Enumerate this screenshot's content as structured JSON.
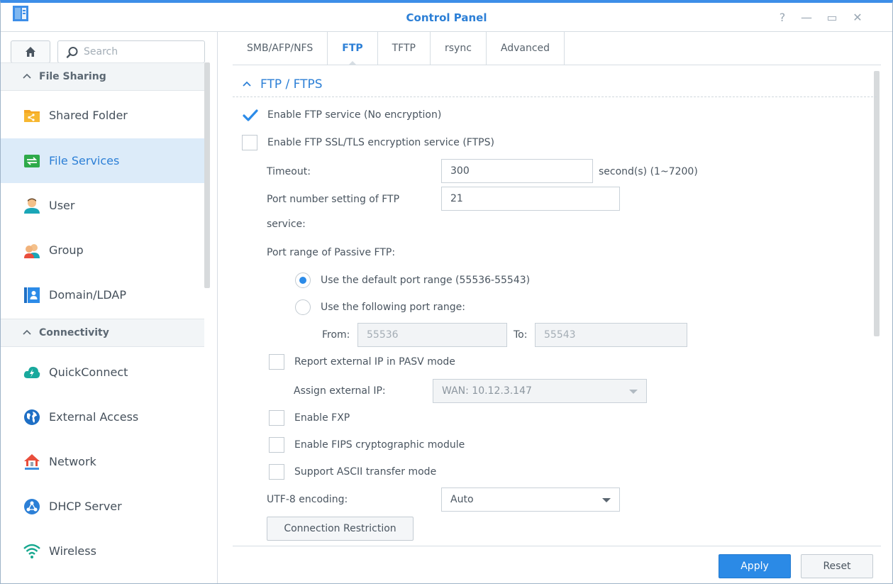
{
  "window": {
    "title": "Control Panel",
    "controls": {
      "help": "?",
      "minimize": "—",
      "maximize": "▭",
      "close": "✕"
    }
  },
  "sidebar": {
    "search_placeholder": "Search",
    "sections": [
      {
        "label": "File Sharing",
        "items": [
          {
            "label": "Shared Folder",
            "icon": "shared-folder-icon"
          },
          {
            "label": "File Services",
            "icon": "file-services-icon",
            "active": true
          },
          {
            "label": "User",
            "icon": "user-icon"
          },
          {
            "label": "Group",
            "icon": "group-icon"
          },
          {
            "label": "Domain/LDAP",
            "icon": "domain-ldap-icon"
          }
        ]
      },
      {
        "label": "Connectivity",
        "items": [
          {
            "label": "QuickConnect",
            "icon": "quickconnect-icon"
          },
          {
            "label": "External Access",
            "icon": "external-access-icon"
          },
          {
            "label": "Network",
            "icon": "network-icon"
          },
          {
            "label": "DHCP Server",
            "icon": "dhcp-server-icon"
          },
          {
            "label": "Wireless",
            "icon": "wireless-icon"
          }
        ]
      }
    ]
  },
  "tabs": [
    {
      "label": "SMB/AFP/NFS"
    },
    {
      "label": "FTP",
      "active": true
    },
    {
      "label": "TFTP"
    },
    {
      "label": "rsync"
    },
    {
      "label": "Advanced"
    }
  ],
  "ftp": {
    "section_title": "FTP / FTPS",
    "enable_ftp": {
      "label": "Enable FTP service (No encryption)",
      "checked": true
    },
    "enable_ftps": {
      "label": "Enable FTP SSL/TLS encryption service (FTPS)",
      "checked": false
    },
    "timeout": {
      "label": "Timeout:",
      "value": "300",
      "unit": "second(s) (1~7200)"
    },
    "port": {
      "label_line1": "Port number setting of FTP",
      "label_line2": "service:",
      "value": "21"
    },
    "passive": {
      "label": "Port range of Passive FTP:",
      "default_range": {
        "label": "Use the default port range (55536-55543)",
        "selected": true
      },
      "custom_range": {
        "label": "Use the following port range:",
        "selected": false
      },
      "from_label": "From:",
      "from_value": "55536",
      "to_label": "To:",
      "to_value": "55543"
    },
    "report_external_ip": {
      "label": "Report external IP in PASV mode",
      "checked": false
    },
    "assign_external_ip": {
      "label": "Assign external IP:",
      "value": "WAN: 10.12.3.147"
    },
    "enable_fxp": {
      "label": "Enable FXP",
      "checked": false
    },
    "enable_fips": {
      "label": "Enable FIPS cryptographic module",
      "checked": false
    },
    "ascii_mode": {
      "label": "Support ASCII transfer mode",
      "checked": false
    },
    "utf8": {
      "label": "UTF-8 encoding:",
      "value": "Auto"
    },
    "connection_restriction": "Connection Restriction"
  },
  "footer": {
    "apply": "Apply",
    "reset": "Reset"
  },
  "colors": {
    "accent": "#2c7fd6",
    "active_bg": "#dcebf9",
    "primary_button": "#2b8ae6"
  }
}
